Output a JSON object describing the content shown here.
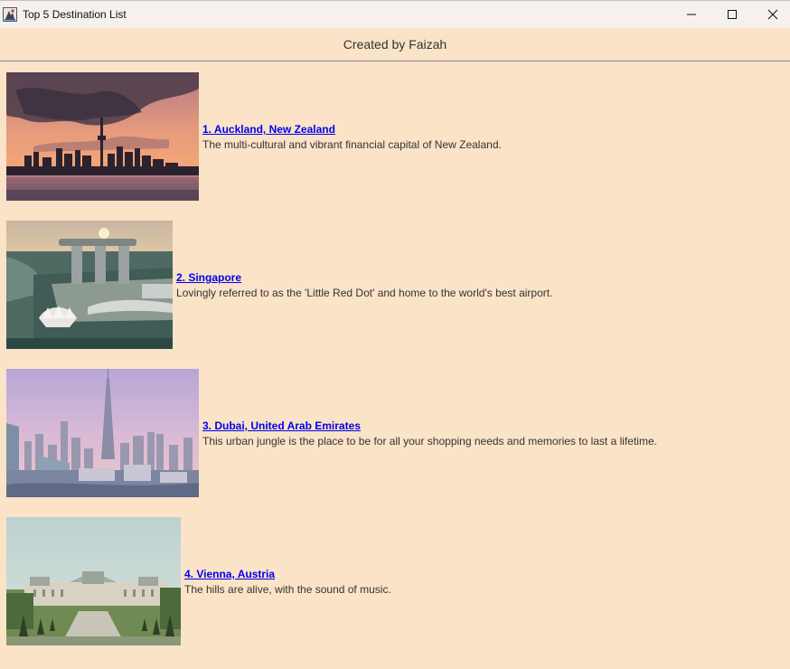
{
  "window": {
    "title": "Top 5 Destination List"
  },
  "header": {
    "credit": "Created by Faizah"
  },
  "destinations": [
    {
      "title": "1. Auckland, New Zealand",
      "description": "The multi-cultural and vibrant financial capital of New Zealand.",
      "image": "auckland-skyline-sunset"
    },
    {
      "title": "2. Singapore",
      "description": "Lovingly referred to as the 'Little Red Dot' and home to the world's best airport.",
      "image": "singapore-marina-bay-aerial"
    },
    {
      "title": "3. Dubai, United Arab Emirates",
      "description": "This urban jungle is the place to be for all your shopping needs and memories to last a lifetime.",
      "image": "dubai-burj-khalifa-skyline"
    },
    {
      "title": "4. Vienna, Austria",
      "description": "The hills are alive, with the sound of music.",
      "image": "vienna-belvedere-palace-gardens"
    }
  ]
}
